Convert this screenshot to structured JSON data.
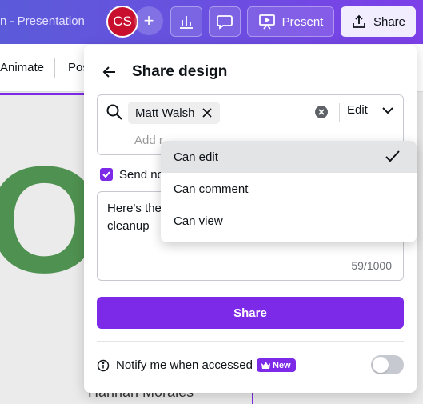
{
  "topbar": {
    "doc_title": "n - Presentation",
    "avatar_initials": "CS",
    "present_label": "Present",
    "share_label": "Share"
  },
  "toolbar": {
    "animate_label": "Animate",
    "position_label": "Pos"
  },
  "canvas": {
    "big_text": "OL",
    "name_text": "Hannah Morales"
  },
  "panel": {
    "title": "Share design",
    "chip_name": "Matt Walsh",
    "permission_value": "Edit",
    "add_people_placeholder": "Add r",
    "notify_label": "Send no",
    "message_text": "Here's the cleanup",
    "char_count": "59/1000",
    "share_button": "Share",
    "notify_access_label": "Notify me when accessed",
    "new_badge": "New"
  },
  "permission_menu": {
    "items": [
      "Can edit",
      "Can comment",
      "Can view"
    ],
    "selected": "Can edit"
  },
  "colors": {
    "brand_purple": "#7d2ae8",
    "avatar_red": "#c8102e",
    "canvas_green": "#4f9150"
  }
}
